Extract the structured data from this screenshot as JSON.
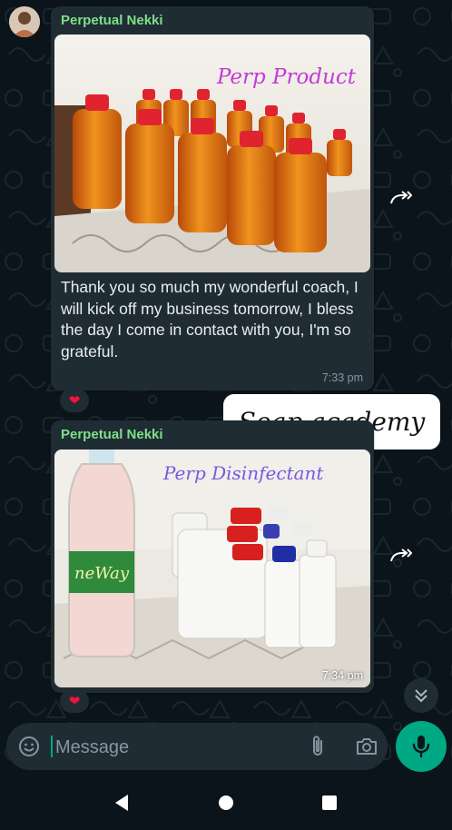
{
  "messages": [
    {
      "sender": "Perpetual Nekki",
      "image_caption": "Perp Product",
      "text": "Thank you so much my wonderful coach, I will kick off my business tomorrow, I bless the day I come in contact with you, I'm so grateful.",
      "time": "7:33 pm",
      "reaction": "❤"
    },
    {
      "sender": "Perpetual Nekki",
      "image_caption": "Perp Disinfectant",
      "bottle_label": "neWay",
      "time": "7:34 pm",
      "reaction": "❤"
    }
  ],
  "overlay_label": "Soap academy",
  "composer": {
    "placeholder": "Message"
  },
  "icons": {
    "forward": "forward-icon",
    "scroll_down": "double-chevron-down-icon",
    "emoji": "emoji-icon",
    "attach": "paperclip-icon",
    "camera": "camera-icon",
    "mic": "microphone-icon",
    "nav_back": "back-triangle-icon",
    "nav_home": "home-circle-icon",
    "nav_recents": "recents-square-icon"
  },
  "colors": {
    "background": "#0b141a",
    "bubble": "#202c33",
    "sender_name": "#7de089",
    "accent": "#00a884",
    "reaction_heart": "#f2133c"
  }
}
